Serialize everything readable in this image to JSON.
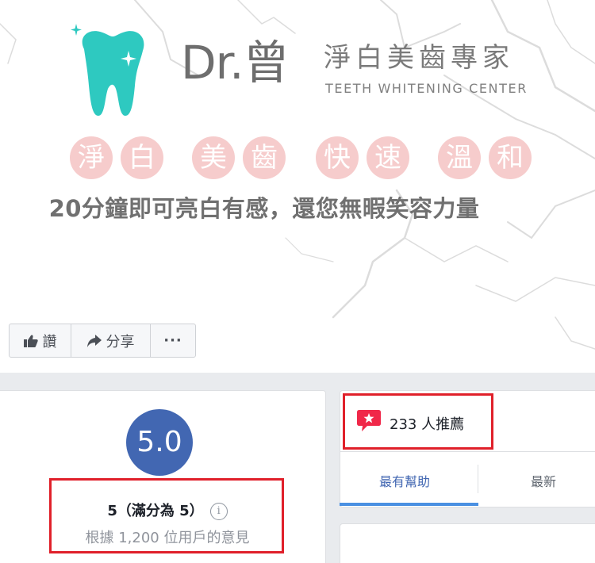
{
  "cover": {
    "brand_name": "Dr.曾",
    "brand_cn": "淨白美齒專家",
    "brand_en": "TEETH WHITENING CENTER",
    "features": [
      "淨",
      "白",
      "美",
      "齒",
      "快",
      "速",
      "溫",
      "和"
    ],
    "tagline": "20分鐘即可亮白有感，還您無暇笑容力量",
    "colors": {
      "tooth": "#2ec9c0",
      "feature_circle": "#f6cccc"
    }
  },
  "actions": {
    "like_label": "讚",
    "share_label": "分享",
    "more_label": "···"
  },
  "rating": {
    "score": "5.0",
    "summary": "5（滿分為 5）",
    "info_icon": "i",
    "basis": "根據 1,200 位用戶的意見",
    "colors": {
      "score_badge": "#4267b2",
      "highlight": "#e0202a"
    }
  },
  "recommendations": {
    "text": "233 人推薦",
    "icon": "recommend-star-icon"
  },
  "tabs": [
    {
      "label": "最有幫助",
      "active": true
    },
    {
      "label": "最新",
      "active": false
    }
  ]
}
